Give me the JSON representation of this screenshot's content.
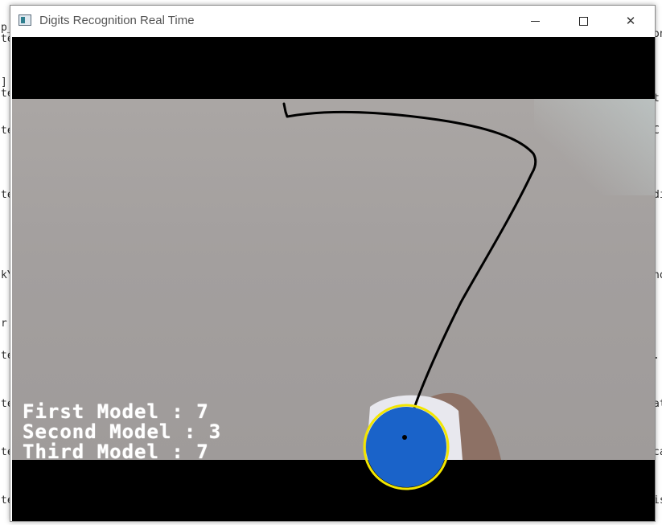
{
  "window": {
    "title": "Digits Recognition Real Time",
    "min_label": "",
    "close_label": "✕"
  },
  "predictions": {
    "first": "First Model : 7",
    "second": "Second Model : 3",
    "third": "Third Model : 7"
  },
  "colors": {
    "marker_fill": "#1a63c9",
    "marker_ring": "#f2e600",
    "trace": "#000000"
  },
  "background_fragments": {
    "left": [
      "p_",
      "te",
      "",
      "",
      "]",
      "te",
      "",
      "te",
      "",
      "",
      "te",
      "",
      "",
      "",
      "",
      "kY",
      "",
      "",
      "r.",
      "",
      "te",
      "",
      "",
      "te",
      "",
      "",
      "te",
      "",
      "",
      "te"
    ],
    "right": [
      "",
      "on",
      "",
      "",
      "",
      "t",
      "",
      "C",
      "",
      "",
      "di",
      "",
      "",
      "",
      "",
      "ho",
      "",
      "",
      "",
      "",
      ".",
      "",
      "",
      "at",
      "",
      "",
      "ca",
      "",
      "",
      "is"
    ]
  }
}
